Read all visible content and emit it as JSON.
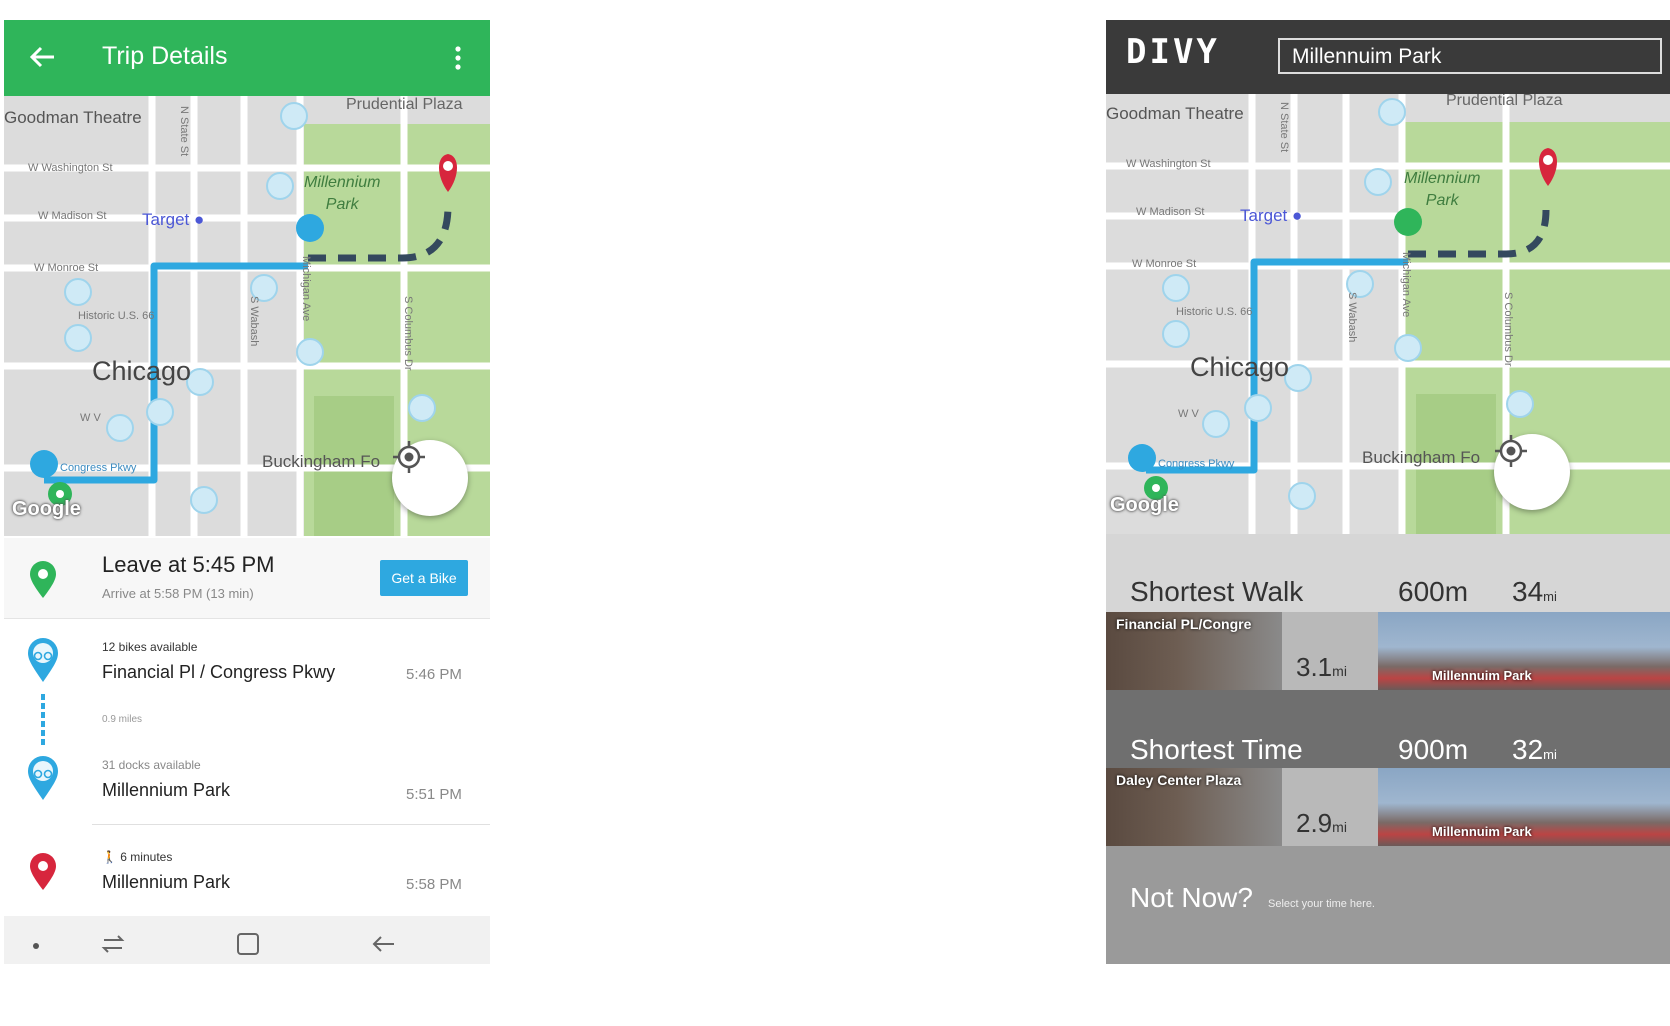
{
  "left_app": {
    "appbar": {
      "title": "Trip Details"
    },
    "map": {
      "labels": {
        "theatre": "Goodman Theatre",
        "prudential": "Prudential Plaza",
        "washington": "W Washington St",
        "madison": "W Madison St",
        "monroe": "W Monroe St",
        "historic": "Historic U.S. 66",
        "city": "Chicago",
        "wv": "W V",
        "park_line1": "Millennium",
        "park_line2": "Park",
        "target": "Target",
        "buckingham": "Buckingham Fo",
        "congress": "Congress Pkwy",
        "state": "N State St",
        "michigan": "Michigan Ave",
        "wabash": "S Wabash",
        "columbus": "S Columbus Dr",
        "google": "Google"
      }
    },
    "leave": {
      "title": "Leave at 5:45 PM",
      "subtitle": "Arrive at 5:58 PM (13 min)",
      "button": "Get a Bike"
    },
    "steps": [
      {
        "meta": "12 bikes available",
        "title": "Financial Pl / Congress Pkwy",
        "time": "5:46 PM"
      },
      {
        "meta": "31 docks available",
        "title": "Millennium Park",
        "time": "5:51 PM"
      },
      {
        "meta": "6 minutes",
        "title": "Millennium Park",
        "time": "5:58 PM"
      }
    ],
    "distance": "0.9 miles",
    "colors": {
      "green": "#2fb55a",
      "blue": "#2ea8e0",
      "red": "#d7263d"
    }
  },
  "right_app": {
    "brand": "DIVY",
    "search_value": "Millennuim Park",
    "routes": [
      {
        "name": "Shortest Walk",
        "meters": "600m",
        "mins": "34",
        "mins_unit": "mi",
        "from": "Financial PL/Congre",
        "dist": "3.1",
        "dist_unit": "mi",
        "to": "Millennuim Park"
      },
      {
        "name": "Shortest Time",
        "meters": "900m",
        "mins": "32",
        "mins_unit": "mi",
        "from": "Daley Center Plaza",
        "dist": "2.9",
        "dist_unit": "mi",
        "to": "Millennuim Park"
      }
    ],
    "not_now": "Not Now?",
    "not_now_sub": "Select your time here."
  }
}
